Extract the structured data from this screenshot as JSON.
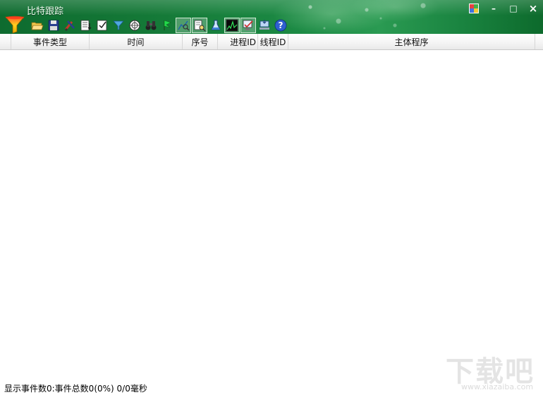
{
  "window": {
    "title": "比特跟踪",
    "controls": {
      "maximize_icon": "color-window-icon",
      "minimize": "–",
      "restore": "□",
      "close": "×"
    }
  },
  "toolbar": {
    "buttons": [
      {
        "name": "open-folder-icon"
      },
      {
        "name": "save-disk-icon"
      },
      {
        "name": "filter-tools-icon"
      },
      {
        "name": "export-list-icon"
      },
      {
        "name": "checklist-icon"
      },
      {
        "name": "funnel-down-icon"
      },
      {
        "name": "target-icon"
      },
      {
        "name": "binoculars-icon"
      },
      {
        "name": "green-flag-icon"
      },
      {
        "name": "chart-magnifier-icon",
        "pressed": true
      },
      {
        "name": "document-zoom-icon",
        "pressed": true
      },
      {
        "name": "flask-icon"
      },
      {
        "name": "cpu-graph-icon",
        "pressed": true
      },
      {
        "name": "network-check-icon",
        "pressed": true
      },
      {
        "name": "computer-arrow-icon"
      },
      {
        "name": "help-icon"
      }
    ]
  },
  "table": {
    "columns": [
      "事件类型",
      "时间",
      "序号",
      "进程ID",
      "线程ID",
      "主体程序"
    ],
    "rows": []
  },
  "status": {
    "text": "显示事件数0:事件总数0(0%) 0/0毫秒"
  },
  "watermark": {
    "text": "下载吧",
    "url": "www.xiazaiba.com"
  },
  "colors": {
    "title_band": "#157a38",
    "header_bg": "#f4f4f4",
    "body_bg": "#ffffff"
  }
}
